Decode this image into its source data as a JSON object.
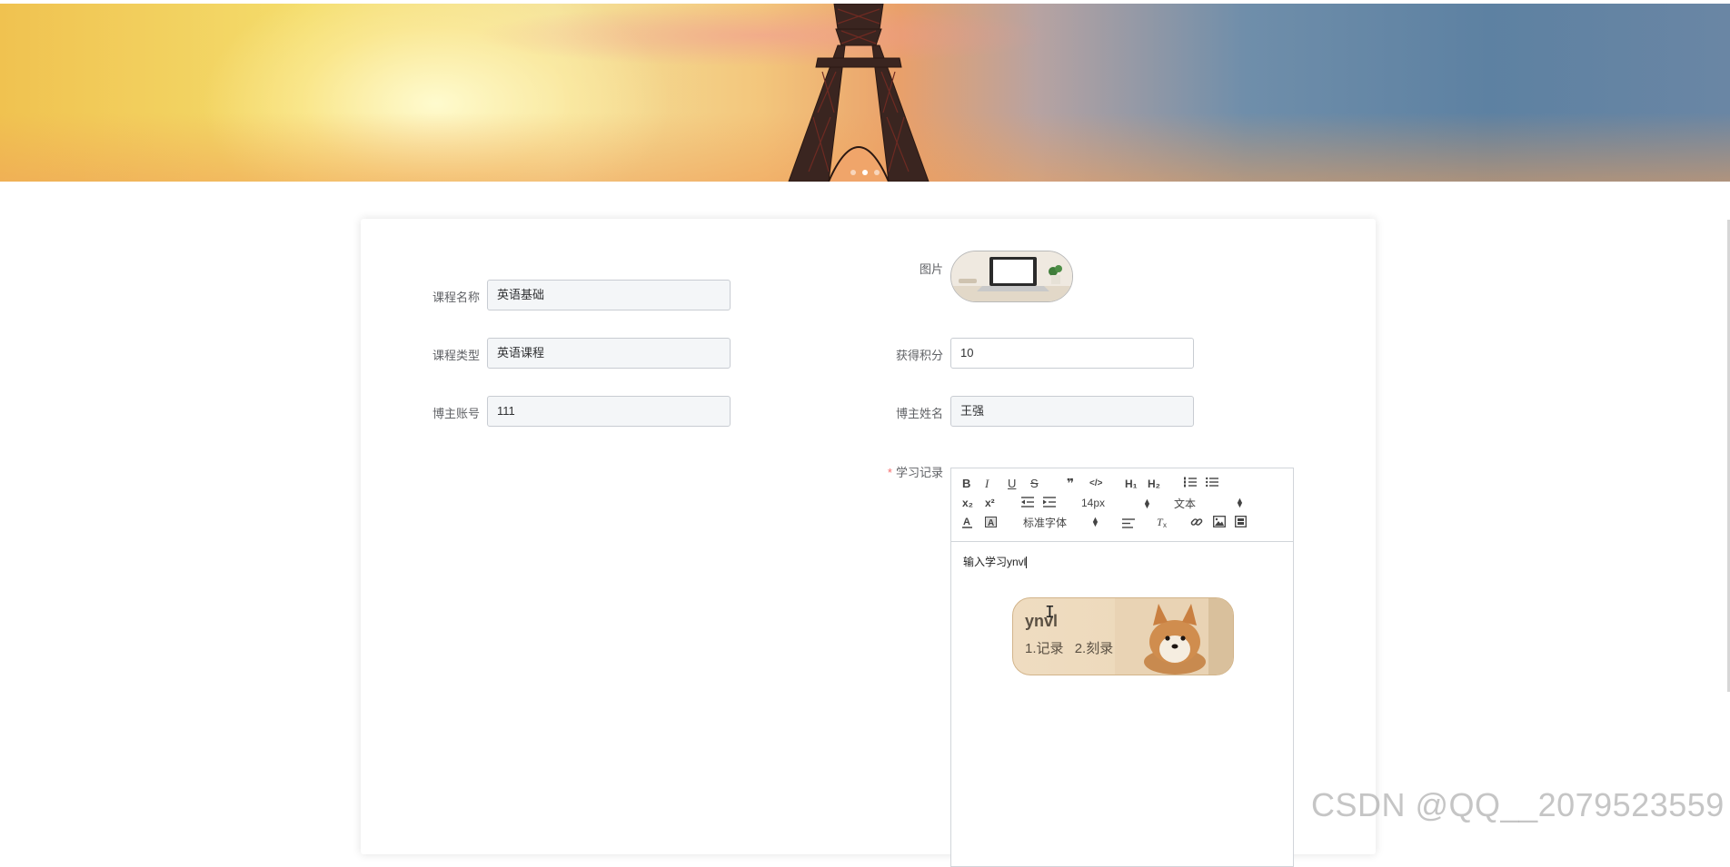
{
  "carousel": {
    "slide_count": 3,
    "active_index": 1
  },
  "form": {
    "course_name": {
      "label": "课程名称",
      "value": "英语基础"
    },
    "course_type": {
      "label": "课程类型",
      "value": "英语课程"
    },
    "blogger_account": {
      "label": "博主账号",
      "value": "111"
    },
    "image": {
      "label": "图片"
    },
    "points": {
      "label": "获得积分",
      "value": "10"
    },
    "blogger_name": {
      "label": "博主姓名",
      "value": "王强"
    },
    "study_record": {
      "required_mark": "*",
      "label": "学习记录",
      "content": "输入学习ynvl"
    }
  },
  "editor_toolbar": {
    "bold": "B",
    "italic": "I",
    "underline": "U",
    "strike": "S",
    "quote": "❞",
    "code": "</>",
    "h1": "H₁",
    "h2": "H₂",
    "subscript": "x₂",
    "superscript": "x²",
    "font_size": "14px",
    "header_type": "文本",
    "font_family": "标准字体"
  },
  "ime_popup": {
    "pinyin": "ynvl",
    "candidates": [
      "1.记录",
      "2.刻录"
    ]
  },
  "watermark": "CSDN @QQ__2079523559",
  "colors": {
    "required": "#f56c6c",
    "label": "#606266",
    "input_bg": "#f4f6f8"
  }
}
